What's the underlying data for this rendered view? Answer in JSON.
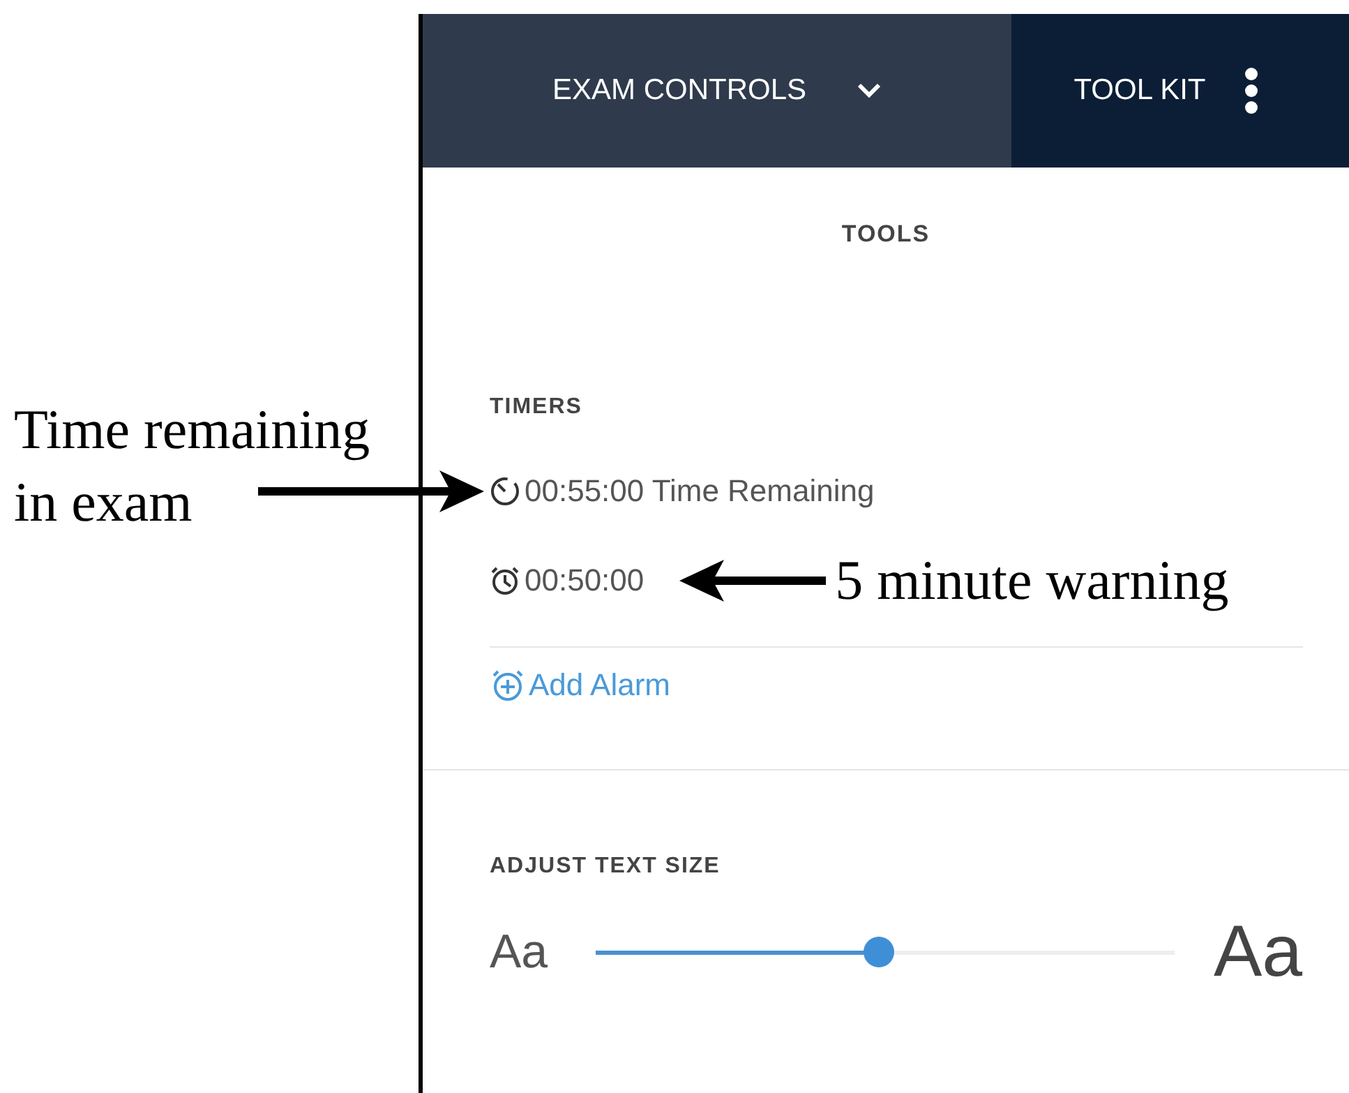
{
  "header": {
    "tabs": [
      {
        "label": "EXAM CONTROLS",
        "kind": "dropdown"
      },
      {
        "label": "TOOL KIT",
        "kind": "menu"
      }
    ]
  },
  "section_title": "TOOLS",
  "timers": {
    "heading": "TIMERS",
    "items": [
      {
        "kind": "countdown",
        "time": "00:55:00",
        "label": "Time Remaining"
      },
      {
        "kind": "alarm",
        "time": "00:50:00"
      }
    ],
    "add_button": "Add Alarm"
  },
  "text_size": {
    "heading": "ADJUST TEXT SIZE",
    "small_label": "Aa",
    "large_label": "Aa",
    "level": 0.49
  },
  "annotations": [
    {
      "lines": [
        "Time remaining",
        "in exam"
      ]
    },
    {
      "lines": [
        "5 minute warning"
      ]
    }
  ]
}
